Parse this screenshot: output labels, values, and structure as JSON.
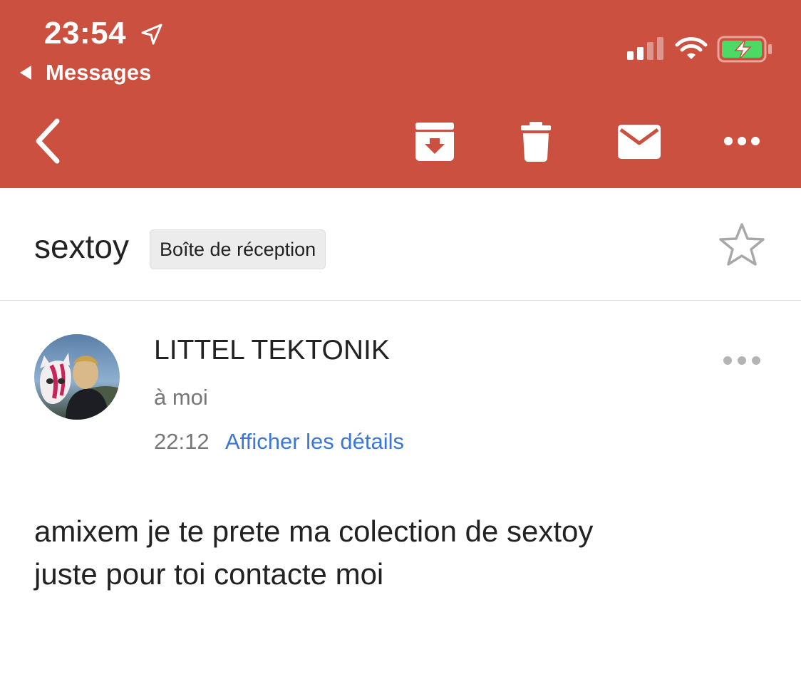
{
  "status_bar": {
    "time": "23:54",
    "back_app_label": "Messages",
    "icons": [
      "location-arrow-icon",
      "cellular-signal-icon",
      "wifi-icon",
      "battery-charging-icon"
    ]
  },
  "toolbar": {
    "icons": [
      "back-chevron-icon",
      "archive-icon",
      "trash-icon",
      "mail-icon",
      "more-icon"
    ],
    "accent_color": "#cb5040"
  },
  "email": {
    "subject": "sextoy",
    "label": "Boîte de réception",
    "sender_name": "LITTEL TEKTONIK",
    "recipient": "à moi",
    "time": "22:12",
    "details_link": "Afficher les détails",
    "body_line_1": "amixem je te prete ma colection de sextoy",
    "body_line_2": "juste pour toi contacte moi"
  }
}
